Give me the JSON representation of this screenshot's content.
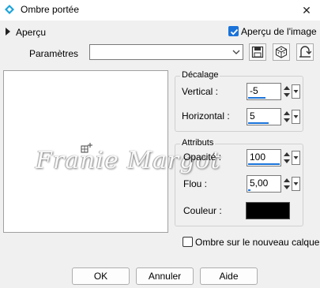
{
  "window": {
    "title": "Ombre portée",
    "close_glyph": "✕"
  },
  "preview": {
    "expander_label": "Aperçu",
    "toggle_label": "Aperçu de l'image",
    "toggle_checked": true,
    "watermark": "Franie Margot"
  },
  "presets": {
    "label": "Paramètres",
    "value": "",
    "tool_icons": [
      "save-icon",
      "dice-icon",
      "reset-icon"
    ]
  },
  "offset": {
    "title": "Décalage",
    "vertical_label": "Vertical :",
    "vertical_value": "-5",
    "horizontal_label": "Horizontal :",
    "horizontal_value": "5"
  },
  "attributes": {
    "title": "Attributs",
    "opacity_label": "Opacité :",
    "opacity_value": "100",
    "blur_label": "Flou :",
    "blur_value": "5,00",
    "color_label": "Couleur :",
    "color_value": "#000000"
  },
  "new_layer": {
    "label": "Ombre sur le nouveau calque",
    "checked": false
  },
  "buttons": {
    "ok": "OK",
    "cancel": "Annuler",
    "help": "Aide"
  },
  "colors": {
    "accent": "#1a73d9",
    "background": "#f0f0f0"
  }
}
